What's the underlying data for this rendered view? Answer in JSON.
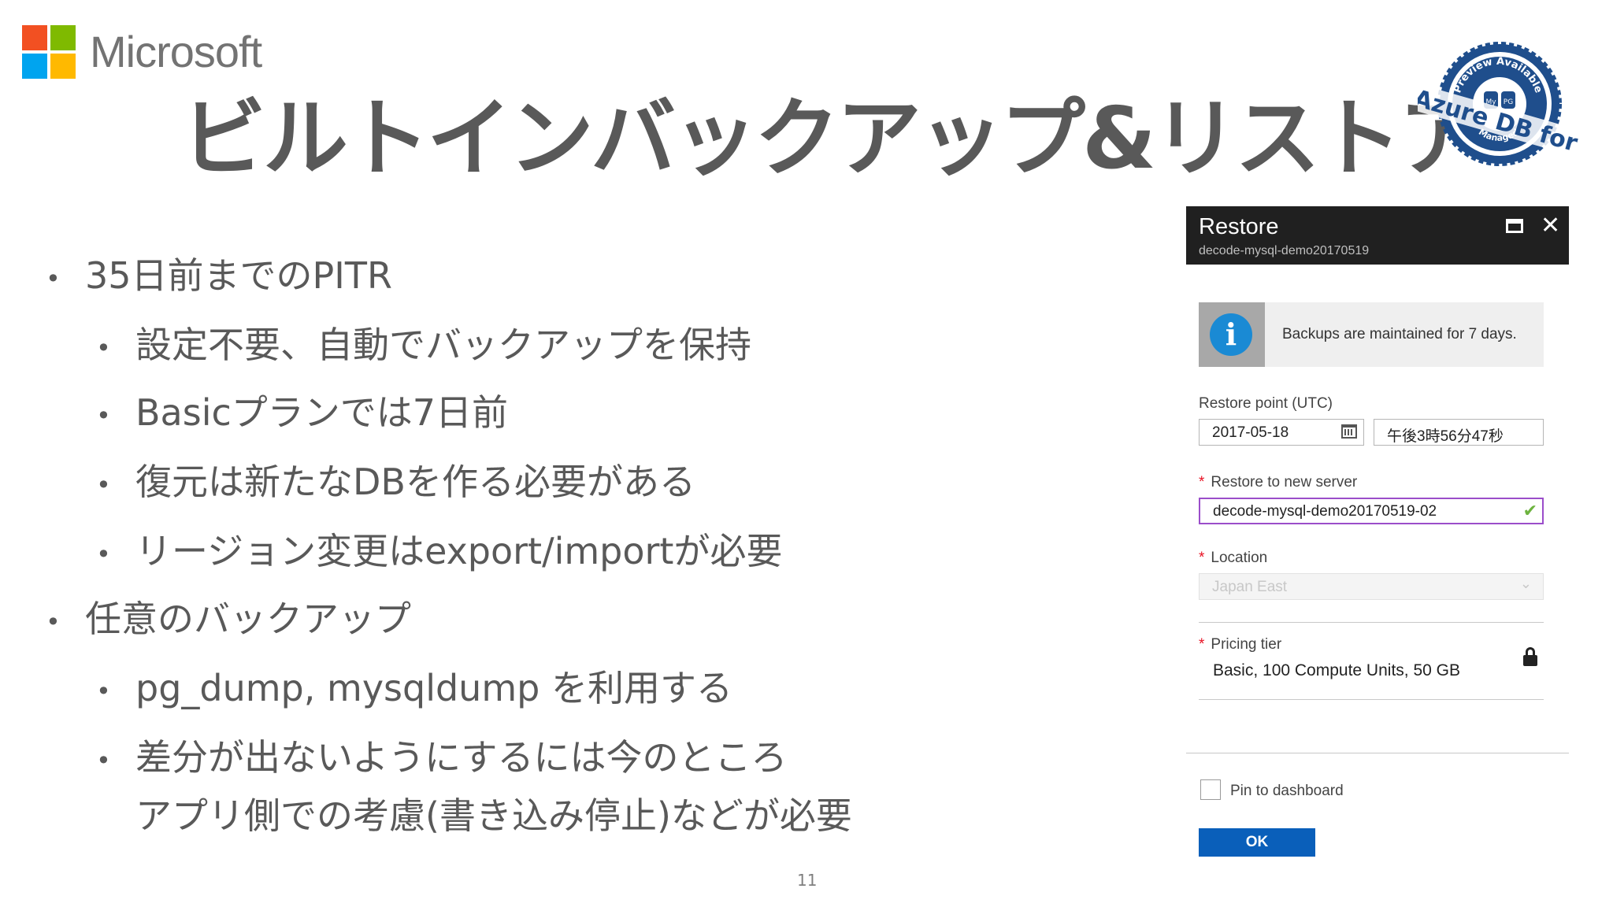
{
  "brand": {
    "name": "Microsoft"
  },
  "slide": {
    "title": "ビルトインバックアップ&リストア",
    "page_number": "11",
    "badge": {
      "text_top": "Preview Available",
      "text_main": "Azure DB for",
      "text_bottom": "Managed",
      "inner_left": "My",
      "inner_right": "PG"
    },
    "bullets": [
      {
        "level": 1,
        "text": "35日前までのPITR"
      },
      {
        "level": 2,
        "text": "設定不要、自動でバックアップを保持"
      },
      {
        "level": 2,
        "text": "Basicプランでは7日前"
      },
      {
        "level": 2,
        "text": "復元は新たなDBを作る必要がある"
      },
      {
        "level": 2,
        "text": "リージョン変更はexport/importが必要"
      },
      {
        "level": 1,
        "text": "任意のバックアップ"
      },
      {
        "level": 2,
        "text": "pg_dump, mysqldump を利用する"
      },
      {
        "level": 2,
        "text": "差分が出ないようにするには今のところ"
      },
      {
        "level": 2,
        "text": "アプリ側での考慮(書き込み停止)などが必要",
        "continuation": true
      }
    ]
  },
  "panel": {
    "title": "Restore",
    "subtitle": "decode-mysql-demo20170519",
    "info": "Backups are maintained for 7 days.",
    "restore_point_label": "Restore point (UTC)",
    "restore_date": "2017-05-18",
    "restore_time": "午後3時56分47秒",
    "new_server_label": "Restore to new server",
    "new_server_value": "decode-mysql-demo20170519-02",
    "location_label": "Location",
    "location_value": "Japan East",
    "pricing_label": "Pricing tier",
    "pricing_value": "Basic, 100 Compute Units, 50 GB",
    "required_mark": "*",
    "pin_label": "Pin to dashboard",
    "ok_label": "OK"
  },
  "colors": {
    "ms_red": "#f25022",
    "ms_green": "#7fba00",
    "ms_blue": "#00a4ef",
    "ms_yellow": "#ffb900",
    "badge_blue": "#1f4e8c",
    "ok_blue": "#0a5fba"
  }
}
